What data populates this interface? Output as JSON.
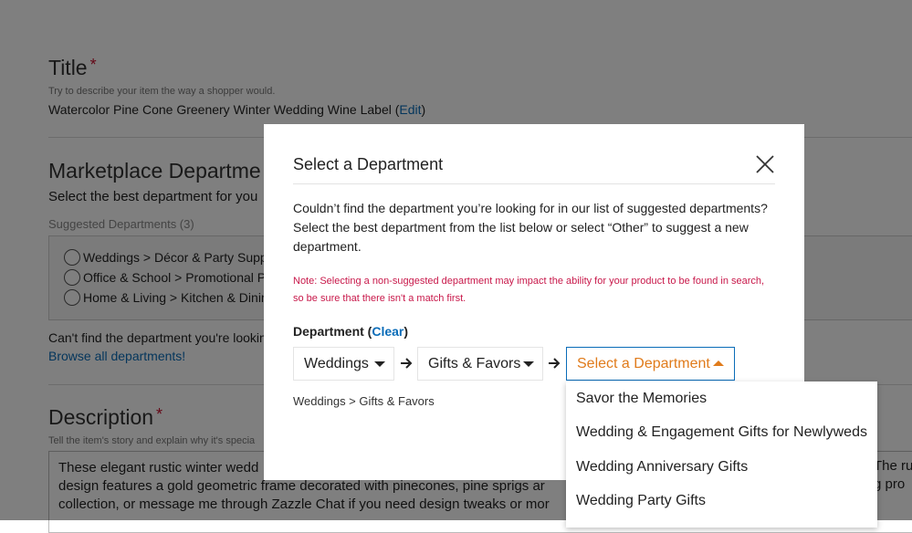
{
  "form": {
    "title_section": {
      "heading": "Title",
      "required_mark": "*",
      "hint": "Try to describe your item the way a shopper would.",
      "value": "Watercolor Pine Cone Greenery Winter Wedding Wine Label",
      "edit_open": "(",
      "edit_label": "Edit",
      "edit_close": ")"
    },
    "marketplace_section": {
      "heading": "Marketplace Departme",
      "subheading": "Select the best department for you",
      "suggested_label": "Suggested Departments (3)",
      "options": [
        "Weddings > Décor & Party Suppli",
        "Office & School > Promotional Pr",
        "Home & Living > Kitchen & Dining"
      ],
      "cant_find": "Can't find the department you're lookin",
      "browse_link": "Browse all departments!"
    },
    "description_section": {
      "heading": "Description",
      "required_mark": "*",
      "hint": "Tell the item's story and explain why it's specia",
      "lines": [
        "These elegant rustic winter wedd",
        "design features a gold geometric frame decorated with pinecones, pine sprigs ar",
        "collection, or message me through Zazzle Chat if you need design tweaks or mor"
      ],
      "right_fragments": [
        "The ru",
        "g pro"
      ]
    }
  },
  "modal": {
    "title": "Select a Department",
    "close_icon": "close-icon",
    "description": "Couldn’t find the department you’re looking for in our list of suggested departments? Select the best department from the list below or select “Other” to suggest a new department.",
    "note": "Note: Selecting a non-suggested department may impact the ability for your product to be found in search, so be sure that there isn't a match first.",
    "department_label": "Department (",
    "clear_label": "Clear",
    "department_label_close": ")",
    "selects": [
      {
        "value": "Weddings"
      },
      {
        "value": "Gifts & Favors"
      },
      {
        "value": "Select a Department"
      }
    ],
    "breadcrumb": "Weddings > Gifts & Favors",
    "dropdown_options": [
      "Savor the Memories",
      "Wedding & Engagement Gifts for Newlyweds",
      "Wedding Anniversary Gifts",
      "Wedding Party Gifts"
    ]
  },
  "colors": {
    "link": "#0a6cb8",
    "required": "#c8102e",
    "note": "#c8184a",
    "active_select": "#e07b1b",
    "overlay": "rgba(0,0,0,0.5)"
  }
}
